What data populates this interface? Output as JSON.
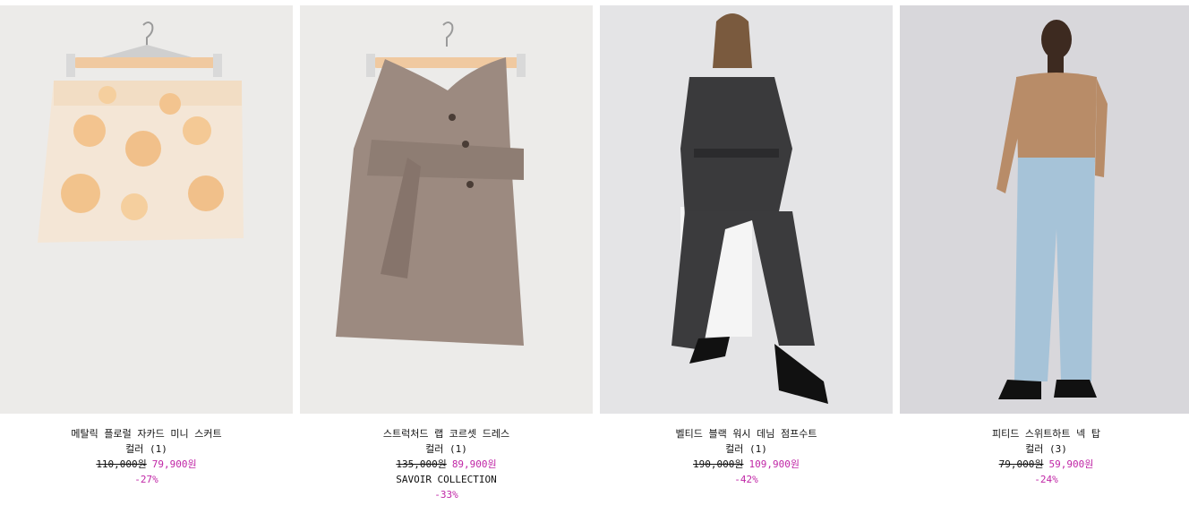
{
  "products": [
    {
      "name": "메탈릭 플로럴 자카드 미니 스커트",
      "rating": "컬러 (1)",
      "old_price": "110,000원",
      "new_price": "79,900원",
      "collection": "",
      "discount": "-27%",
      "image_icon": "floral-mini-skirt-on-hanger"
    },
    {
      "name": "스트럭처드 랩 코르셋 드레스",
      "rating": "컬러 (1)",
      "old_price": "135,000원",
      "new_price": "89,900원",
      "collection": "SAVOIR COLLECTION",
      "discount": "-33%",
      "image_icon": "corset-dress-on-hanger"
    },
    {
      "name": "벨티드 블랙 워시 데님 점프수트",
      "rating": "컬러 (1)",
      "old_price": "190,000원",
      "new_price": "109,900원",
      "collection": "",
      "discount": "-42%",
      "image_icon": "model-in-denim-jumpsuit"
    },
    {
      "name": "피티드 스위트하트 넥 탑",
      "rating": "컬러 (3)",
      "old_price": "79,000원",
      "new_price": "59,900원",
      "collection": "",
      "discount": "-24%",
      "image_icon": "model-in-sweetheart-top"
    }
  ],
  "colors": {
    "sale": "#c026a6",
    "text": "#111111",
    "image_bg": "#ebebea"
  }
}
